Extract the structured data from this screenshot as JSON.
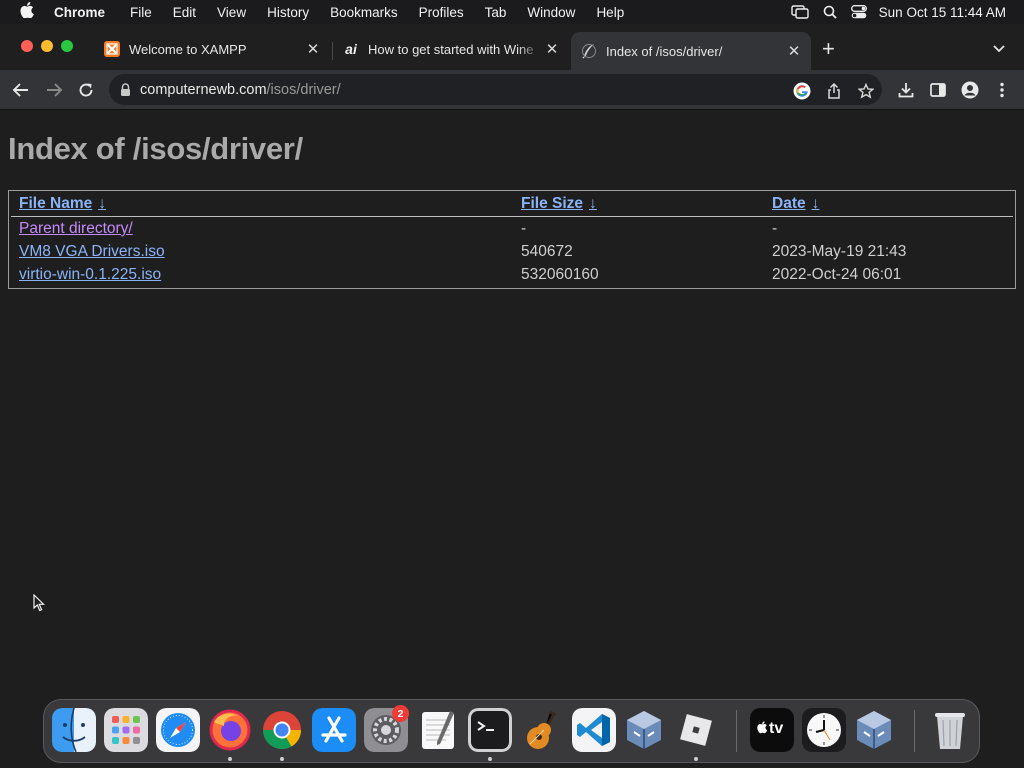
{
  "menubar": {
    "app_name": "Chrome",
    "items": [
      "File",
      "Edit",
      "View",
      "History",
      "Bookmarks",
      "Profiles",
      "Tab",
      "Window",
      "Help"
    ],
    "clock": "Sun Oct 15  11:44 AM"
  },
  "tabs": [
    {
      "title": "Welcome to XAMPP",
      "favicon": "xampp-icon",
      "active": false
    },
    {
      "title": "How to get started with Wine",
      "favicon": "ai-icon",
      "active": false
    },
    {
      "title": "Index of /isos/driver/",
      "favicon": "apache-feather-icon",
      "active": true
    }
  ],
  "address_bar": {
    "host": "computernewb.com",
    "path": "/isos/driver/"
  },
  "page": {
    "heading": "Index of /isos/driver/",
    "columns": [
      {
        "label": "File Name",
        "sort_indicator": "↓"
      },
      {
        "label": "File Size",
        "sort_indicator": "↓"
      },
      {
        "label": "Date",
        "sort_indicator": "↓"
      }
    ],
    "rows": [
      {
        "name": "Parent directory/",
        "size": "-",
        "date": "-"
      },
      {
        "name": "VM8 VGA Drivers.iso",
        "size": "540672",
        "date": "2023-May-19 21:43"
      },
      {
        "name": "virtio-win-0.1.225.iso",
        "size": "532060160",
        "date": "2022-Oct-24 06:01"
      }
    ]
  },
  "dock": {
    "apps": [
      "finder",
      "launchpad",
      "safari",
      "firefox",
      "chrome",
      "app-store",
      "system-settings",
      "textedit",
      "terminal",
      "garageband",
      "vscode",
      "virtualbox",
      "roblox",
      "apple-tv",
      "clock",
      "virtualbox-2",
      "trash"
    ],
    "system_settings_badge": "2",
    "apple_tv_label": "tv"
  },
  "colors": {
    "link": "#8ab4f8",
    "visited_link": "#c58af9",
    "page_bg": "#1e1e1e",
    "toolbar_bg": "#333438"
  }
}
